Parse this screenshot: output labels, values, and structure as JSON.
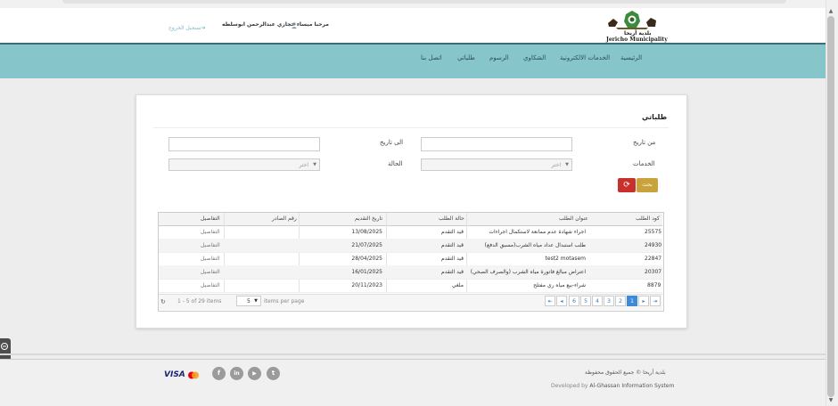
{
  "header": {
    "welcome": "مرحبا ميساء حجازي عبدالرحمن ابوسلطه",
    "logout": "تسجيل الخروج",
    "logo_ar": "بلدية أريحا",
    "logo_en": "Jericho Municipality"
  },
  "nav": {
    "items": [
      "الرئيسية",
      "الخدمات الالكترونية",
      "الشكاوي",
      "الرسوم",
      "طلباتي",
      "اتصل بنا"
    ]
  },
  "page": {
    "title": "طلباتي"
  },
  "filters": {
    "from_date_label": "من تاريخ",
    "to_date_label": "الى تاريخ",
    "services_label": "الخدمات",
    "status_label": "الحالة",
    "services_placeholder": "اختر",
    "status_placeholder": "اختر",
    "search_button": "بحث"
  },
  "table": {
    "headers": [
      "كود الطلب",
      "عنوان الطلب",
      "حالة الطلب",
      "تاريخ التقديم",
      "رقم الصادر",
      "التفاصيل"
    ],
    "rows": [
      {
        "code": "25575",
        "title": "اجراء شهادة عدم ممانعة لاستكمال اجراءات",
        "status": "قيد التقدم",
        "date": "13/08/2025",
        "outgoing": "",
        "details": "التفاصيل"
      },
      {
        "code": "24930",
        "title": "طلب استبدال عداد مياه الشرب(مسبق الدفع)",
        "status": "قيد التقدم",
        "date": "21/07/2025",
        "outgoing": "",
        "details": "التفاصيل"
      },
      {
        "code": "22847",
        "title": "test2 motasem",
        "status": "قيد التقدم",
        "date": "28/04/2025",
        "outgoing": "",
        "details": "التفاصيل"
      },
      {
        "code": "20307",
        "title": "اعتراض مبالغ فاتورة مياه الشرب (والصرف الصحي)",
        "status": "قيد التقدم",
        "date": "16/01/2025",
        "outgoing": "",
        "details": "التفاصيل"
      },
      {
        "code": "8879",
        "title": "شراء-بيع مياه ري مفتلح",
        "status": "ملغي",
        "date": "20/11/2023",
        "outgoing": "",
        "details": "التفاصيل"
      }
    ]
  },
  "pager": {
    "items_info": "1 - 5 of 29 items",
    "page_size": "5",
    "per_page_label": "items per page",
    "pages": [
      "6",
      "5",
      "4",
      "3",
      "2",
      "1"
    ],
    "current_page": "1",
    "first_icon": "first-page-icon",
    "prev_icon": "prev-page-icon",
    "next_icon": "next-page-icon",
    "last_icon": "last-page-icon"
  },
  "footer": {
    "copyright": "بلدية أريحا © جميع الحقوق محفوظة",
    "developed_prefix": "Developed by",
    "developer": "Al-Ghassan Information System",
    "visa": "VISA",
    "social": [
      "facebook-icon",
      "linkedin-icon",
      "youtube-icon",
      "twitter-icon"
    ]
  },
  "colors": {
    "nav": "#86c5ca",
    "reset_button": "#c9302c",
    "search_button": "#c9a23c",
    "active_page": "#3e8ad6"
  }
}
